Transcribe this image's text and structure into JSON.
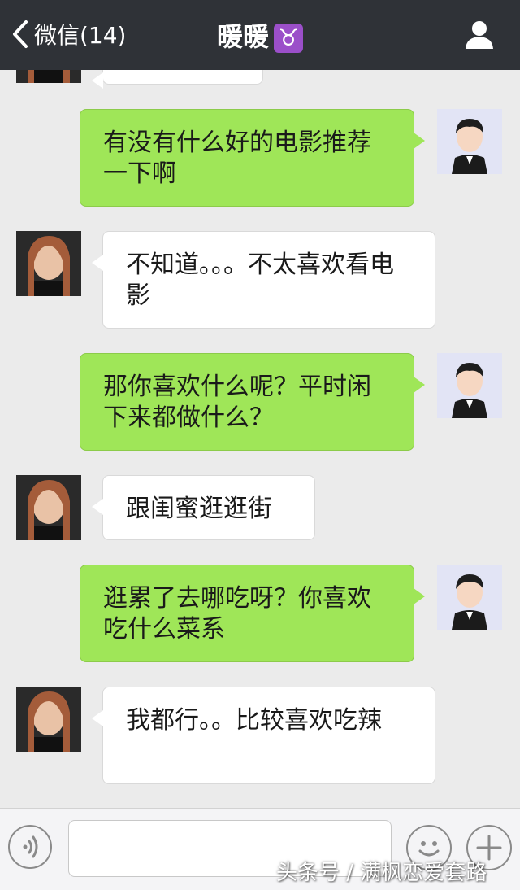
{
  "header": {
    "back_label": "微信(14)",
    "title": "暖暖",
    "title_sign": "♉",
    "profile_icon": "person-icon"
  },
  "colors": {
    "header_bg": "#2f3237",
    "chat_bg": "#ebebeb",
    "sent_bubble": "#9fe658",
    "received_bubble": "#ffffff"
  },
  "messages": [
    {
      "from": "contact",
      "text": ""
    },
    {
      "from": "me",
      "text": "有没有什么好的电影推荐一下啊"
    },
    {
      "from": "contact",
      "text": "不知道。。。不太喜欢看电影"
    },
    {
      "from": "me",
      "text": "那你喜欢什么呢？平时闲下来都做什么？"
    },
    {
      "from": "contact",
      "text": "跟闺蜜逛逛街"
    },
    {
      "from": "me",
      "text": "逛累了去哪吃呀？你喜欢吃什么菜系"
    },
    {
      "from": "contact",
      "text": "我都行。。比较喜欢吃辣"
    }
  ],
  "input_bar": {
    "voice_icon": "voice-icon",
    "input_value": "",
    "emoji_icon": "emoji-icon",
    "plus_icon": "plus-icon"
  },
  "watermark": "头条号 / 满枫恋爱套路"
}
